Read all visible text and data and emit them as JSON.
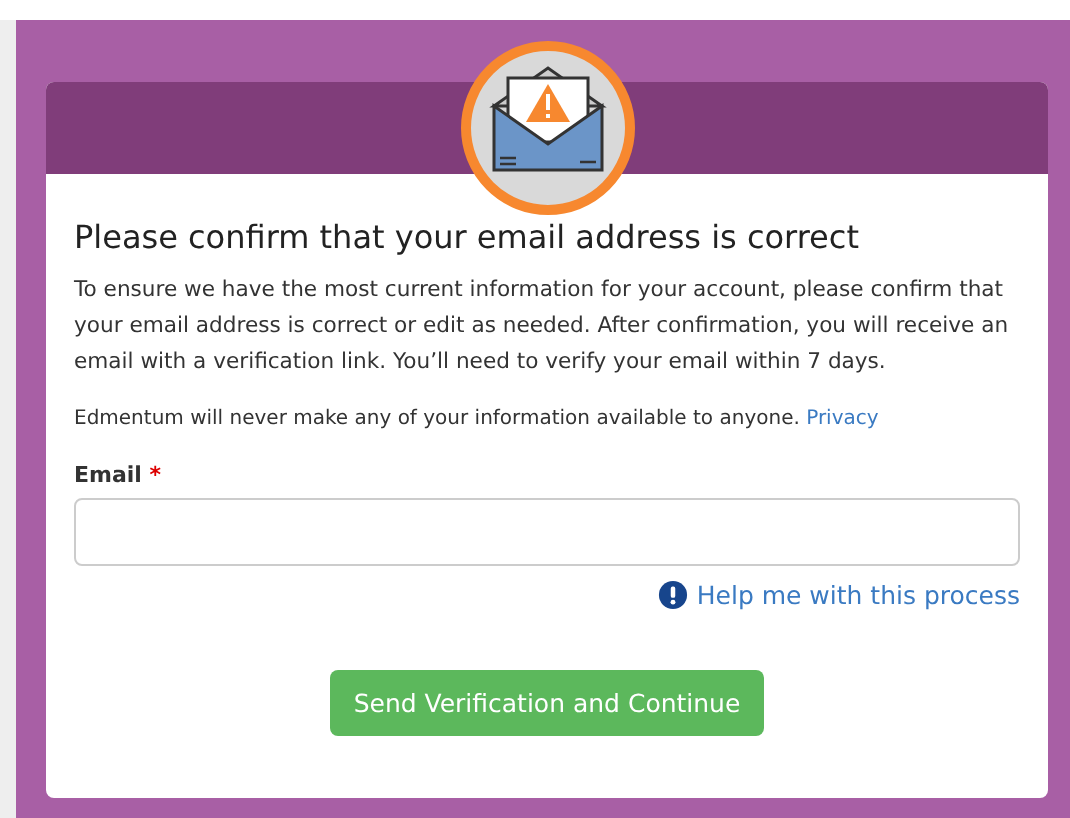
{
  "dialog": {
    "title": "Please confirm that your email address is correct",
    "intro": "To ensure we have the most current information for your account, please confirm that your email address is correct or edit as needed. After confirmation, you will receive an email with a verification link. You’ll need to verify your email within 7 days.",
    "privacy_note": "Edmentum will never make any of your information available to anyone.",
    "privacy_link": "Privacy",
    "email_field": {
      "label": "Email",
      "required_mark": "*"
    },
    "help_link": "Help me with this process",
    "submit_button": "Send Verification and Continue"
  }
}
